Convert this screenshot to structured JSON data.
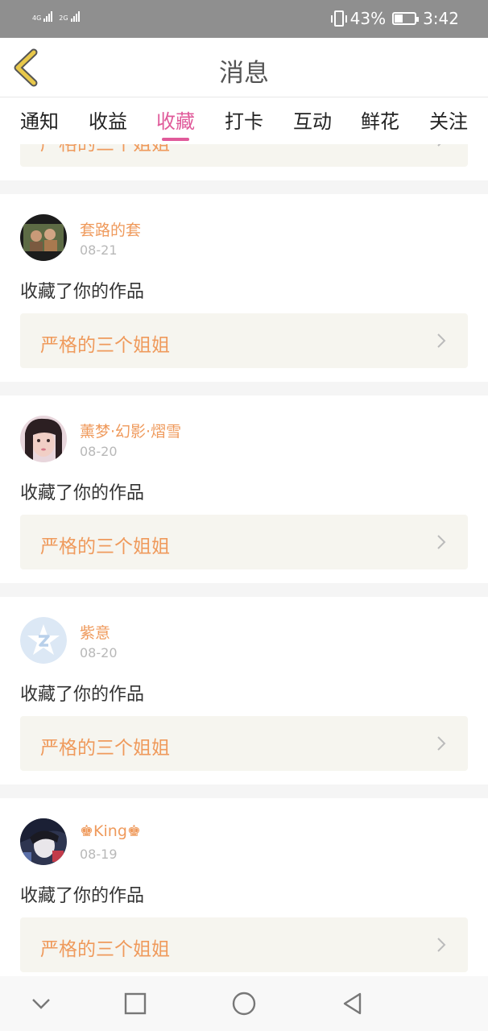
{
  "status_bar": {
    "signal_1": "4G",
    "signal_2": "2G",
    "battery_percent": "43%",
    "battery_level": 0.43,
    "time": "3:42",
    "icons": [
      "vibrate-icon",
      "battery-icon",
      "signal-icon"
    ]
  },
  "header": {
    "title": "消息",
    "back_icon": "chevron-left-icon"
  },
  "tabs": [
    {
      "label": "通知"
    },
    {
      "label": "收益"
    },
    {
      "label": "收藏",
      "active": true
    },
    {
      "label": "打卡"
    },
    {
      "label": "互动"
    },
    {
      "label": "鲜花"
    },
    {
      "label": "关注"
    }
  ],
  "partial_card": {
    "work_title": "严格的三个姐姐"
  },
  "items": [
    {
      "username": "套路的套",
      "date": "08-21",
      "action": "收藏了你的作品",
      "work_title": "严格的三个姐姐"
    },
    {
      "username": "薰梦·幻影·熠雪",
      "date": "08-20",
      "action": "收藏了你的作品",
      "work_title": "严格的三个姐姐"
    },
    {
      "username": "紫意",
      "date": "08-20",
      "action": "收藏了你的作品",
      "work_title": "严格的三个姐姐"
    },
    {
      "username": "♚King♚",
      "date": "08-19",
      "action": "收藏了你的作品",
      "work_title": "严格的三个姐姐"
    }
  ],
  "navbar": {
    "icons": [
      "collapse-icon",
      "recents-icon",
      "home-icon",
      "back-icon"
    ]
  },
  "colors": {
    "accent": "#e05a9a",
    "username": "#ef9a5c",
    "link_bg": "#f6f5ef",
    "back_arrow": "#e8c84a"
  }
}
